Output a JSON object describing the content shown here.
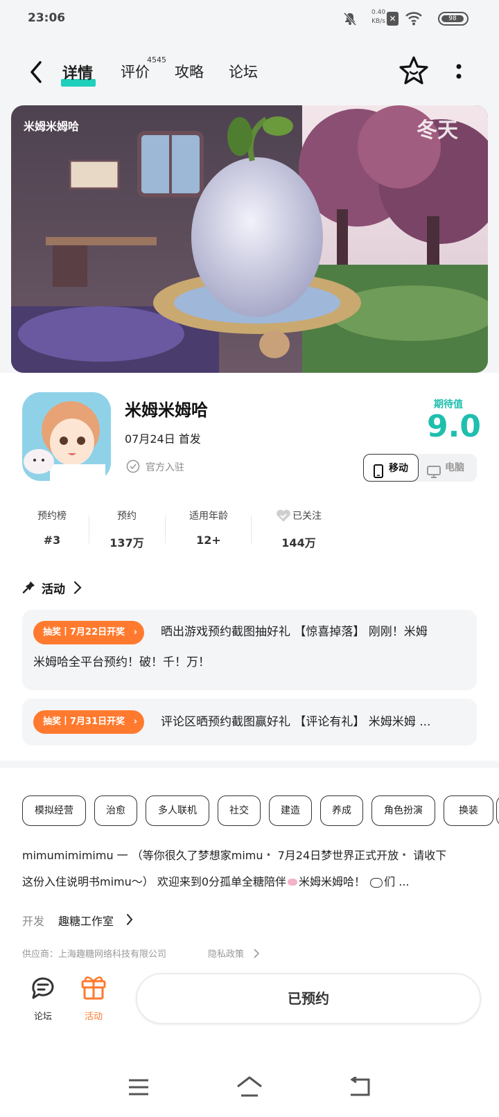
{
  "status": {
    "time": "23:06",
    "net_speed_value": "0.40",
    "net_speed_unit": "KB/s",
    "battery": "98"
  },
  "header": {
    "tabs": [
      {
        "label": "详情"
      },
      {
        "label": "评价"
      },
      {
        "label": "攻略"
      },
      {
        "label": "论坛"
      }
    ],
    "review_count": "4545"
  },
  "banner": {
    "logo_text": "米姆米姆哈",
    "season_text": "冬天"
  },
  "app": {
    "name": "米姆米姆哈",
    "release": "07月24日  首发",
    "official": "官方入驻",
    "expect_label": "期待值",
    "expect_score": "9.0",
    "platform_mobile": "移动",
    "platform_pc": "电脑"
  },
  "stats": [
    {
      "label": "预约榜",
      "value": "#3"
    },
    {
      "label": "预约",
      "value": "137万"
    },
    {
      "label": "适用年龄",
      "value": "12+"
    },
    {
      "label": "已关注",
      "value": "144万"
    }
  ],
  "activity": {
    "title": "活动",
    "items": [
      {
        "badge": "抽奖丨7月22日开奖",
        "text_line1": "晒出游戏预约截图抽好礼  【惊喜掉落】 刚刚！米姆",
        "text_line2": "米姆哈全平台预约！破！千！万！"
      },
      {
        "badge": "抽奖丨7月31日开奖",
        "text_line1": "评论区晒预约截图赢好礼  【评论有礼】 米姆米姆 ..."
      }
    ]
  },
  "tags": [
    "模拟经营",
    "治愈",
    "多人联机",
    "社交",
    "建造",
    "养成",
    "角色扮演",
    "换装"
  ],
  "description": {
    "line1": "mimumimimimu 一  （等你很久了梦想家mimu﹡ 7月24日梦世界正式开放﹡ 请收下",
    "line2": "这份入住说明书mimu～）  欢迎来到0分孤单全糖陪伴",
    "line2b": "米姆米姆哈！",
    "line2c": "们 ..."
  },
  "developer": {
    "label": "开发",
    "value": "趣糖工作室"
  },
  "supplier": "供应商：上海趣糖网络科技有限公司",
  "privacy": "隐私政策",
  "bottom": {
    "forum_label": "论坛",
    "activity_label": "活动",
    "reserve_button": "已预约"
  },
  "colors": {
    "accent": "#1fd0bc",
    "score": "#1fbfae",
    "orange": "#ff7a2e"
  }
}
